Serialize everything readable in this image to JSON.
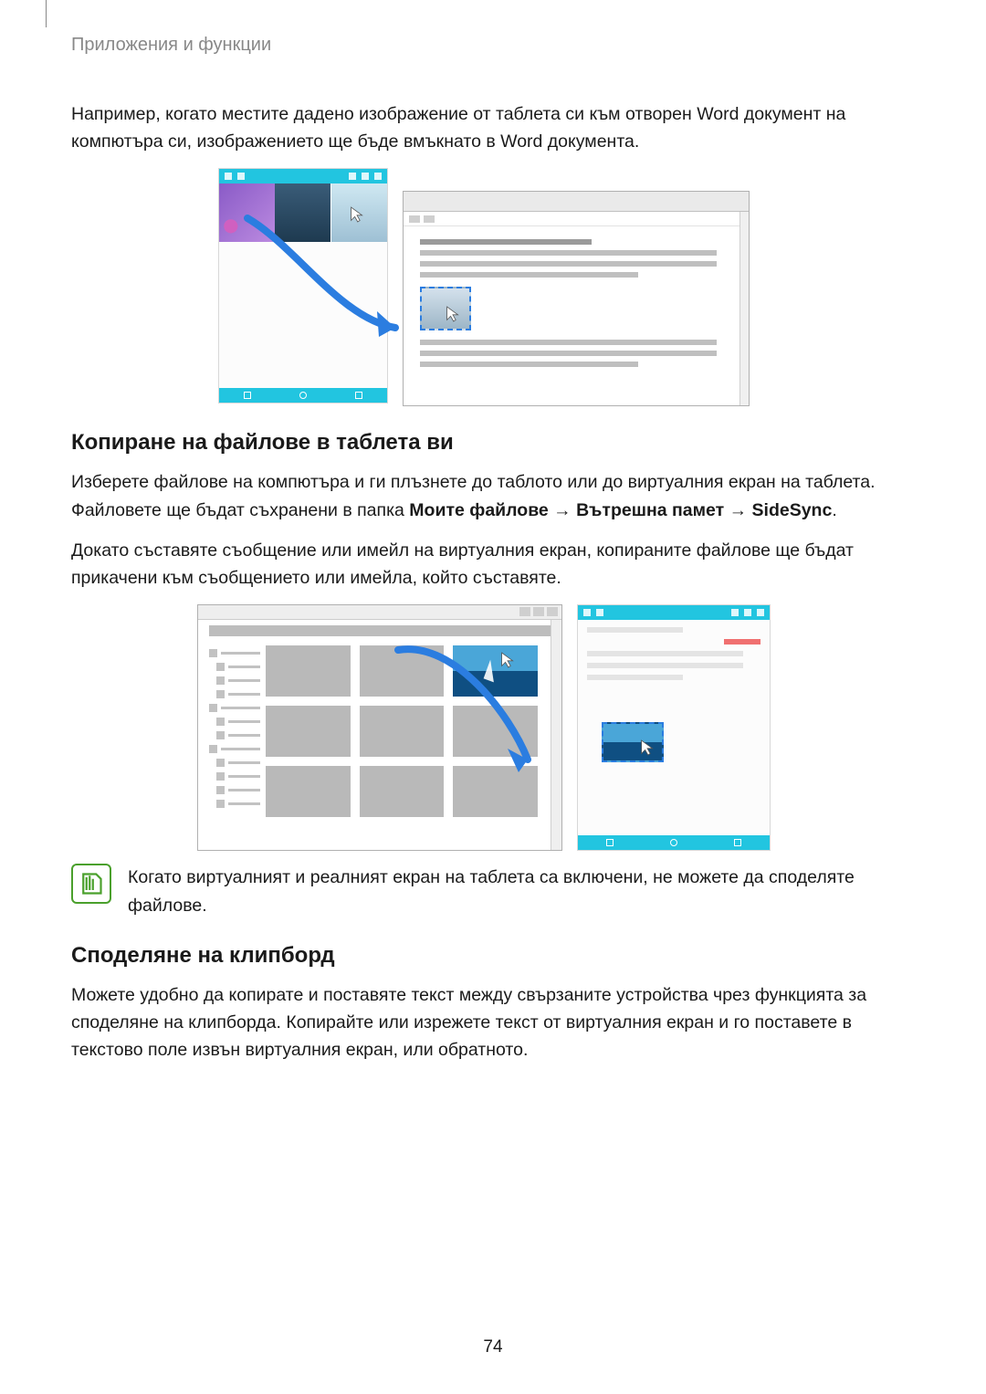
{
  "header": {
    "section": "Приложения и функции"
  },
  "intro": {
    "p1": "Например, когато местите дадено изображение от таблета си към отворен Word документ на компютъра си, изображението ще бъде вмъкнато в Word документа."
  },
  "section1": {
    "heading": "Копиране на файлове в таблета ви",
    "p1a": "Изберете файлове на компютъра и ги плъзнете до таблото или до виртуалния екран на таблета. Файловете ще бъдат съхранени в папка ",
    "p1b_bold": "Моите файлове → Вътрешна памет → SideSync",
    "p1c": ".",
    "p2": "Докато съставяте съобщение или имейл на виртуалния екран, копираните файлове ще бъдат прикачени към съобщението или имейла, който съставяте."
  },
  "note": {
    "text": "Когато виртуалният и реалният екран на таблета са включени, не можете да споделяте файлове."
  },
  "section2": {
    "heading": "Споделяне на клипборд",
    "p1": "Можете удобно да копирате и поставяте текст между свързаните устройства чрез функцията за споделяне на клипборда. Копирайте или изрежете текст от виртуалния екран и го поставете в текстово поле извън виртуалния екран, или обратното."
  },
  "page": {
    "number": "74"
  }
}
